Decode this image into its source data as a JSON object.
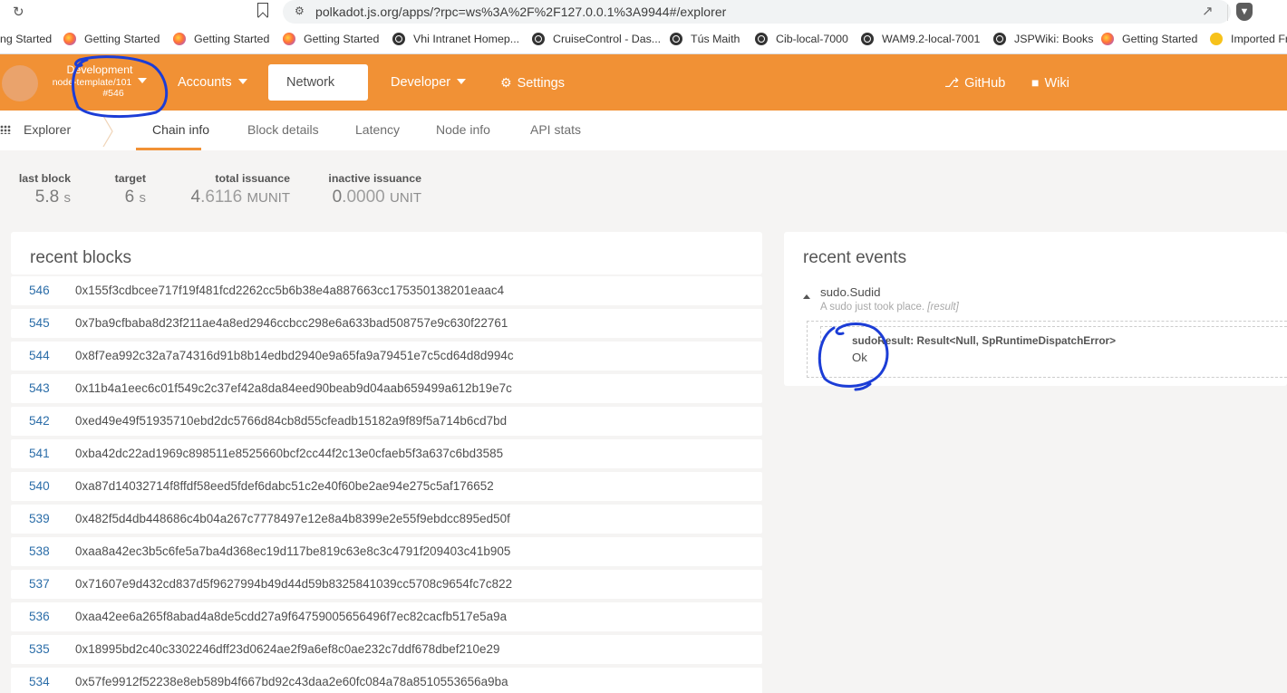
{
  "browser": {
    "url": "polkadot.js.org/apps/?rpc=ws%3A%2F%2F127.0.0.1%3A9944#/explorer",
    "bookmarks": [
      {
        "label": "ng Started",
        "icon": "firefox-icon"
      },
      {
        "label": "Getting Started",
        "icon": "firefox-icon"
      },
      {
        "label": "Getting Started",
        "icon": "firefox-icon"
      },
      {
        "label": "Getting Started",
        "icon": "firefox-icon"
      },
      {
        "label": "Vhi Intranet Homep...",
        "icon": "globe-icon"
      },
      {
        "label": "CruiseControl - Das...",
        "icon": "globe-icon"
      },
      {
        "label": "Tús Maith",
        "icon": "globe-icon"
      },
      {
        "label": "Cib-local-7000",
        "icon": "globe-icon"
      },
      {
        "label": "WAM9.2-local-7001",
        "icon": "globe-icon"
      },
      {
        "label": "JSPWiki: Books",
        "icon": "globe-icon"
      },
      {
        "label": "Getting Started",
        "icon": "firefox-icon"
      },
      {
        "label": "Imported Fr",
        "icon": "folder-icon"
      }
    ]
  },
  "header": {
    "chain_name": "Development",
    "chain_spec": "node-template/101",
    "chain_block": "#546",
    "nav": {
      "accounts": "Accounts",
      "network": "Network",
      "developer": "Developer",
      "settings": "Settings",
      "github": "GitHub",
      "wiki": "Wiki"
    },
    "accent_color": "#f19135"
  },
  "subnav": {
    "section": "Explorer",
    "tabs": [
      "Chain info",
      "Block details",
      "Latency",
      "Node info",
      "API stats"
    ],
    "active_tab": "Chain info"
  },
  "summary": {
    "last_block": {
      "label": "last block",
      "value": "5.8",
      "unit": "s"
    },
    "target": {
      "label": "target",
      "value": "6",
      "unit": "s"
    },
    "total_issuance": {
      "label": "total issuance",
      "int": "4",
      "dec": ".6116",
      "unit": "MUNIT"
    },
    "inactive_issuance": {
      "label": "inactive issuance",
      "int": "0",
      "dec": ".0000",
      "unit": "UNIT"
    }
  },
  "recent_blocks": {
    "title": "recent blocks",
    "rows": [
      {
        "number": "546",
        "hash": "0x155f3cdbcee717f19f481fcd2262cc5b6b38e4a887663cc175350138201eaac4"
      },
      {
        "number": "545",
        "hash": "0x7ba9cfbaba8d23f211ae4a8ed2946ccbcc298e6a633bad508757e9c630f22761"
      },
      {
        "number": "544",
        "hash": "0x8f7ea992c32a7a74316d91b8b14edbd2940e9a65fa9a79451e7c5cd64d8d994c"
      },
      {
        "number": "543",
        "hash": "0x11b4a1eec6c01f549c2c37ef42a8da84eed90beab9d04aab659499a612b19e7c"
      },
      {
        "number": "542",
        "hash": "0xed49e49f51935710ebd2dc5766d84cb8d55cfeadb15182a9f89f5a714b6cd7bd"
      },
      {
        "number": "541",
        "hash": "0xba42dc22ad1969c898511e8525660bcf2cc44f2c13e0cfaeb5f3a637c6bd3585"
      },
      {
        "number": "540",
        "hash": "0xa87d14032714f8ffdf58eed5fdef6dabc51c2e40f60be2ae94e275c5af176652"
      },
      {
        "number": "539",
        "hash": "0x482f5d4db448686c4b04a267c7778497e12e8a4b8399e2e55f9ebdcc895ed50f"
      },
      {
        "number": "538",
        "hash": "0xaa8a42ec3b5c6fe5a7ba4d368ec19d117be819c63e8c3c4791f209403c41b905"
      },
      {
        "number": "537",
        "hash": "0x71607e9d432cd837d5f9627994b49d44d59b8325841039cc5708c9654fc7c822"
      },
      {
        "number": "536",
        "hash": "0xaa42ee6a265f8abad4a8de5cdd27a9f64759005656496f7ec82cacfb517e5a9a"
      },
      {
        "number": "535",
        "hash": "0x18995bd2c40c3302246dff23d0624ae2f9a6ef8c0ae232c7ddf678dbef210e29"
      },
      {
        "number": "534",
        "hash": "0x57fe9912f52238e8eb589b4f667bd92c43daa2e60fc084a78a8510553656a9ba"
      }
    ]
  },
  "recent_events": {
    "title": "recent events",
    "event": {
      "name": "sudo.Sudid",
      "desc": "A sudo just took place.",
      "desc_tag": "[result]",
      "param_label": "sudoResult: Result<Null, SpRuntimeDispatchError>",
      "param_value": "Ok"
    }
  }
}
